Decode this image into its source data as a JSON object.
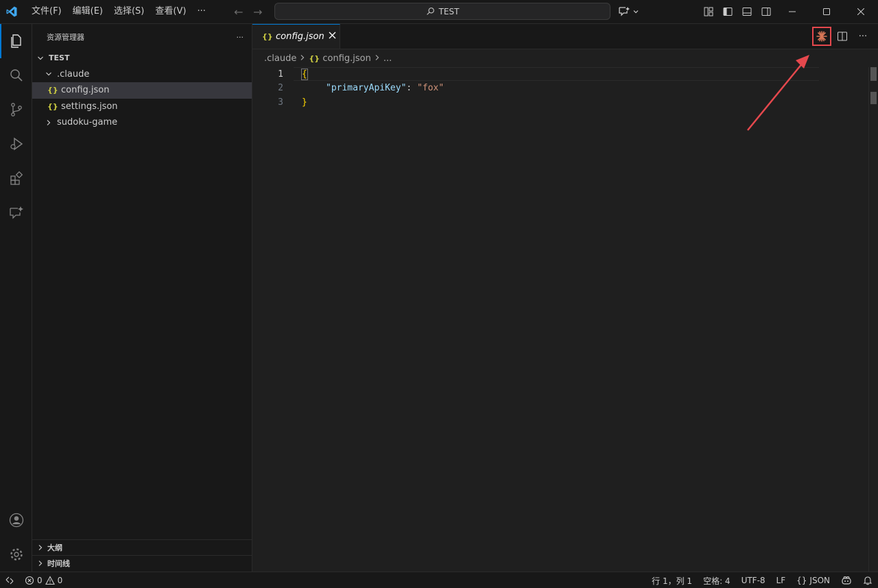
{
  "titlebar": {
    "menu": [
      "文件(F)",
      "编辑(E)",
      "选择(S)",
      "查看(V)",
      "···"
    ],
    "search_text": "TEST"
  },
  "sidebar": {
    "title": "资源管理器",
    "more": "···",
    "root": "TEST",
    "tree": [
      {
        "label": ".claude",
        "type": "folder",
        "expanded": true
      },
      {
        "label": "config.json",
        "type": "json",
        "selected": true
      },
      {
        "label": "settings.json",
        "type": "json"
      },
      {
        "label": "sudoku-game",
        "type": "folder",
        "expanded": false
      }
    ],
    "outline": "大纲",
    "timeline": "时间线"
  },
  "editor": {
    "tab_label": "config.json",
    "tab_icon": "{}",
    "breadcrumb": [
      ".claude",
      "config.json",
      "..."
    ],
    "lines": [
      {
        "no": "1",
        "text": "{"
      },
      {
        "no": "2",
        "key": "\"primaryApiKey\"",
        "sep": ": ",
        "value": "\"fox\""
      },
      {
        "no": "3",
        "text": "}"
      }
    ]
  },
  "statusbar": {
    "errors": "0",
    "warnings": "0",
    "position": "行 1，列 1",
    "spaces": "空格: 4",
    "encoding": "UTF-8",
    "eol": "LF",
    "language": "JSON",
    "language_icon": "{}"
  },
  "colors": {
    "accent": "#0078d4",
    "highlight_box": "#e5484d",
    "claude_orange": "#d97757"
  }
}
